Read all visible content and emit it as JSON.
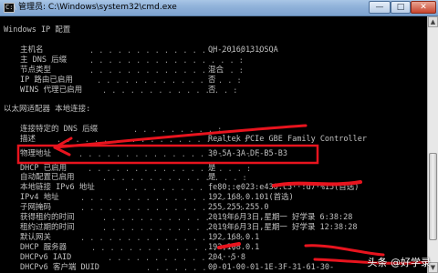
{
  "window": {
    "title": "管理员: C:\\Windows\\system32\\cmd.exe",
    "icon_name": "console-icon",
    "buttons": {
      "minimize": "—",
      "maximize": "□",
      "close": "✕"
    }
  },
  "console": {
    "header": "Windows IP 配置",
    "section1": [
      {
        "label": "主机名",
        "value": "QH-20160131OSQA"
      },
      {
        "label": "主 DNS 后缀",
        "value": ""
      },
      {
        "label": "节点类型",
        "value": "混合"
      },
      {
        "label": "IP 路由已启用",
        "value": "否"
      },
      {
        "label": "WINS 代理已启用",
        "value": "否"
      }
    ],
    "adapter_header": "以太网适配器 本地连接:",
    "section2": [
      {
        "label": "连接特定的 DNS 后缀",
        "value": ""
      },
      {
        "label": "描述",
        "value": "Realtek PCIe GBE Family Controller"
      },
      {
        "label": "物理地址",
        "value": "30-5A-3A-DF-B5-B3"
      },
      {
        "label": "DHCP 已启用",
        "value": "是"
      },
      {
        "label": "自动配置已启用",
        "value": "是"
      },
      {
        "label": "本地链接 IPv6 地址",
        "value": "fe80::e023:e430:c5··:d7·%15(首选)"
      },
      {
        "label": "IPv4 地址",
        "value": "192.168.0.101(首选)"
      },
      {
        "label": "子网掩码",
        "value": "255.255.255.0"
      },
      {
        "label": "获得租约的时间",
        "value": "2019年6月3日,星期一 好学录 6:38:28"
      },
      {
        "label": "租约过期的时间",
        "value": "2019年6月3日,星期一 好学录 12:38:28"
      },
      {
        "label": "默认网关",
        "value": "192.168.0.1"
      },
      {
        "label": "DHCP 服务器",
        "value": "192.168.0.1"
      },
      {
        "label": "DHCPv6 IAID",
        "value": "204··5·8"
      },
      {
        "label": "DHCPv6 客户端 DUID",
        "value": "00-01-00-01-1E-3F-31-61-30-"
      }
    ]
  },
  "annotation": {
    "color": "#e8141e",
    "highlight_line": "物理地址"
  },
  "watermark": {
    "prefix": "头条",
    "at": "@",
    "name": "好学录"
  }
}
